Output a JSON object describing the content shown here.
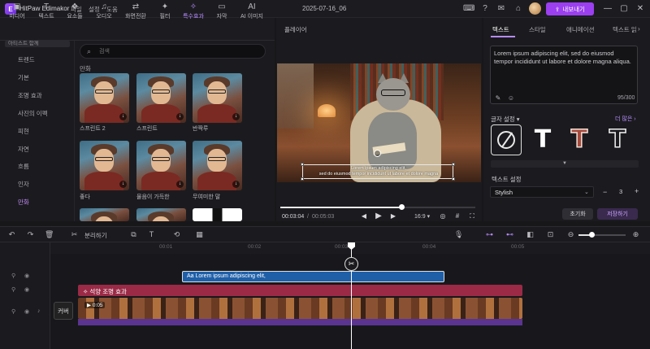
{
  "app": {
    "title": "HitPaw Edimakor",
    "logo": "E",
    "menus": [
      "파일",
      "설정",
      "도움"
    ],
    "doc_title": "2025-07-16_06",
    "export_label": "내보내기",
    "accent": "#9b3ff0"
  },
  "left_tabs": [
    {
      "label": "미디어",
      "icon": "media-icon",
      "glyph": "▣"
    },
    {
      "label": "텍스트",
      "icon": "text-icon",
      "glyph": "T"
    },
    {
      "label": "요소들",
      "icon": "elements-icon",
      "glyph": "❖"
    },
    {
      "label": "오디오",
      "icon": "audio-icon",
      "glyph": "♫"
    },
    {
      "label": "화면전환",
      "icon": "transition-icon",
      "glyph": "⇄"
    },
    {
      "label": "필터",
      "icon": "filter-icon",
      "glyph": "✦"
    },
    {
      "label": "특수효과",
      "icon": "effects-icon",
      "glyph": "✧"
    },
    {
      "label": "자막",
      "icon": "subtitle-icon",
      "glyph": "▭"
    },
    {
      "label": "AI 이미지",
      "icon": "ai-image-icon",
      "glyph": "AI"
    }
  ],
  "sidebar": {
    "header": "아티스트 함께",
    "items": [
      "트렌드",
      "기본",
      "조명 효과",
      "사진의 이펙",
      "피현",
      "자연",
      "흐름",
      "인자",
      "만화"
    ],
    "active_index": 8
  },
  "assets": {
    "search_placeholder": "검색",
    "section": "만화",
    "items": [
      {
        "label": "스프린트 2"
      },
      {
        "label": "스프린트"
      },
      {
        "label": "반짝루"
      },
      {
        "label": "좋다"
      },
      {
        "label": "물음이 가득한"
      },
      {
        "label": "무여미한 말"
      }
    ]
  },
  "player": {
    "title": "플레이어",
    "caption_line1": "Lorem ipsum adipiscing elit,",
    "caption_line2": "sed do eiusmod tempor incididunt ut labore et dolore magna",
    "current_time": "00:03:04",
    "separator": "/",
    "total_time": "00:05:03",
    "aspect_ratio": "16:9",
    "progress": 0.62
  },
  "right_panel": {
    "tabs": [
      "텍스트",
      "스타일",
      "애니메이션",
      "텍스트 읽"
    ],
    "active_tab": 0,
    "text_content": "Lorem ipsum adipiscing elit, sed do eiusmod tempor incididunt ut labore et dolore magna aliqua.",
    "char_count": "95/300",
    "preset_label": "글자 설정",
    "more_label": "더 많은",
    "style_label": "텍스트 설정",
    "font_value": "Stylish",
    "font_size": "3",
    "reset_label": "초기화",
    "save_label": "저장하기"
  },
  "timeline": {
    "split_label": "분리하기",
    "ticks": [
      "00:01",
      "00:02",
      "00:03",
      "00:04",
      "00:05"
    ],
    "text_clip_label": "Aa Lorem ipsum adipiscing elit,",
    "effect_clip_label": "석양 조명 효과",
    "video_clip_duration": "0:05",
    "cover_label": "커버",
    "zoom_level": 0.28
  }
}
